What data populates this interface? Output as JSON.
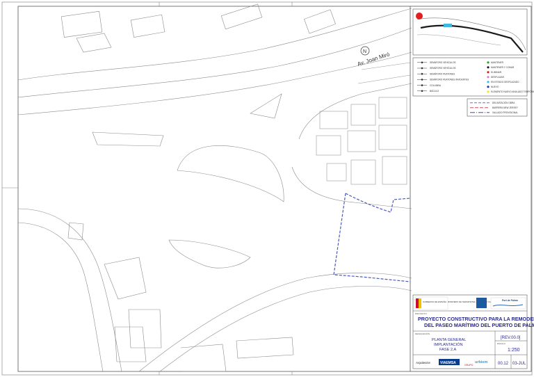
{
  "map": {
    "street_label": "Av. Joan Miró",
    "north_symbol": "N"
  },
  "legend": {
    "left": [
      "SEMÁFORO VEHÍCULOS",
      "SEMÁFORO VEHÍCULOS",
      "SEMÁFORO PEATONES",
      "SEMÁFORO PEATONES INVIDENTES",
      "COLUMNA",
      "BÁCULO"
    ],
    "right": [
      {
        "label": "MANTENER",
        "color": "#2e9e2e"
      },
      {
        "label": "MANTENER Y CONAR",
        "color": "#1a1a1a"
      },
      {
        "label": "ELIMINAR",
        "color": "#d42020"
      },
      {
        "label": "DESPLAZAR",
        "color": "#e07ad0"
      },
      {
        "label": "EN ESTADO DESPLAZADO",
        "color": "#3fb8e0"
      },
      {
        "label": "NUEVO",
        "color": "#2030b0"
      },
      {
        "label": "ELEMENTO NUEVO ANULADO TEMPORALMENTE",
        "color": "#f2e22a"
      }
    ]
  },
  "line_legend": [
    {
      "label": "DELIMITACIÓN OBRA",
      "color": "#4a5ab8",
      "dash": "4 2"
    },
    {
      "label": "BARRERA NEW JERSEY",
      "color": "#c03040",
      "dash": "5 2"
    },
    {
      "label": "VALLADO PROVISIONAL",
      "color": "#2a2a8a",
      "dash": "7 2 1 2"
    }
  ],
  "title_block": {
    "project_label": "PROYECTO",
    "project_title_1": "PROYECTO CONSTRUCTIVO PARA LA REMODELACIÓN",
    "project_title_2": "DEL PASEO MARÍTIMO DEL PUERTO DE PALMA",
    "drawing_label": "DESIGNACIÓN",
    "plan_line_1": "PLANTA GENERAL",
    "plan_line_2": "IMPLANTACIÓN",
    "plan_line_3": "FASE 2.A",
    "rev": "[REV.00.0]",
    "scale_label": "ESCALA",
    "scale": "1:250",
    "plan_no": "00.12",
    "date": "03-JUL",
    "port_authority": "Port de Palma",
    "gov_text": "GOBIERNO DE ESPAÑA",
    "ministry_text": "MINISTERIO DE TRANSPORTES, MOVILIDAD Y AGENDA URBANA",
    "logos": [
      "Arquitectos",
      "VIAEMSA",
      "urbiem",
      "GRUPO"
    ]
  }
}
